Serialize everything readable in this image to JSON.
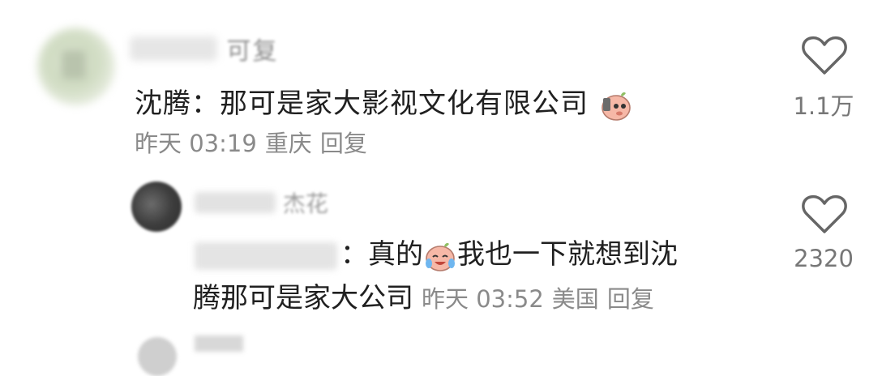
{
  "main_comment": {
    "username_tail": "可复",
    "text": "沈腾：那可是家大影视文化有限公司",
    "emoji": "mouse-peek-emoji",
    "time": "昨天 03:19",
    "location": "重庆",
    "reply_label": "回复",
    "like_count": "1.1万"
  },
  "reply_comment": {
    "username_tail": "杰花",
    "mention_tail": "：",
    "text_part1": "真的",
    "emoji": "crying-laugh-emoji",
    "text_part2": "我也一下就想到沈",
    "text_line2": "腾那可是家大公司",
    "time": "昨天 03:52",
    "location": "美国",
    "reply_label": "回复",
    "like_count": "2320"
  },
  "icons": {
    "like": "heart-outline-icon"
  },
  "colors": {
    "text": "#202020",
    "meta": "#8a8a8a",
    "like_count": "#777777"
  }
}
